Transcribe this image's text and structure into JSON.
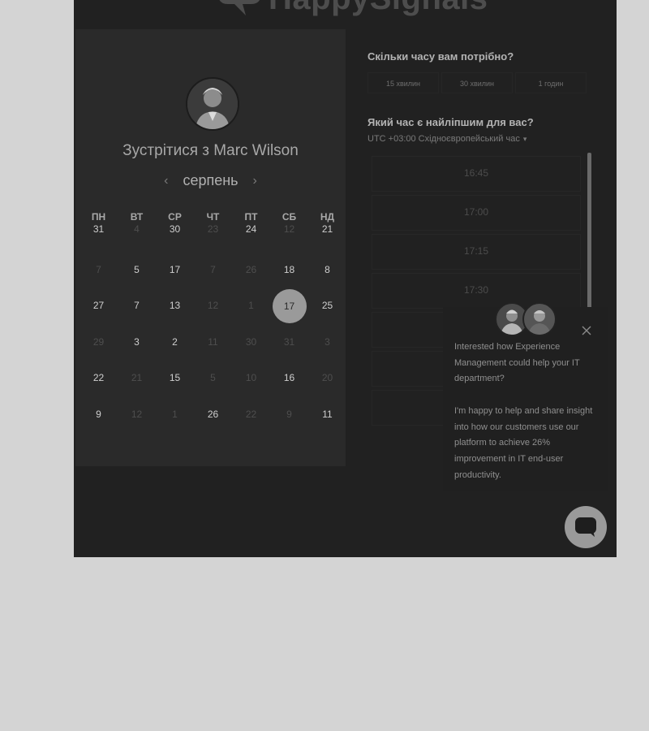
{
  "brand": {
    "name": "HappySignals"
  },
  "meeting": {
    "title": "Зустрітися з Marc Wilson",
    "month": "серпень",
    "weekdays": [
      "ПН",
      "ВТ",
      "СР",
      "ЧТ",
      "ПТ",
      "СБ",
      "НД"
    ],
    "weeks": [
      [
        {
          "d": "31",
          "dim": false
        },
        {
          "d": "4",
          "dim": true
        },
        {
          "d": "30",
          "dim": false
        },
        {
          "d": "23",
          "dim": true
        },
        {
          "d": "24",
          "dim": false
        },
        {
          "d": "12",
          "dim": true
        },
        {
          "d": "21",
          "dim": false
        }
      ],
      [
        {
          "d": "7",
          "dim": true
        },
        {
          "d": "5",
          "dim": false
        },
        {
          "d": "17",
          "dim": false
        },
        {
          "d": "7",
          "dim": true
        },
        {
          "d": "26",
          "dim": true
        },
        {
          "d": "18",
          "dim": false
        },
        {
          "d": "8",
          "dim": false
        }
      ],
      [
        {
          "d": "27",
          "dim": false
        },
        {
          "d": "7",
          "dim": false
        },
        {
          "d": "13",
          "dim": false
        },
        {
          "d": "12",
          "dim": true
        },
        {
          "d": "1",
          "dim": true
        },
        {
          "d": "17",
          "dim": false,
          "sel": true
        },
        {
          "d": "25",
          "dim": false
        }
      ],
      [
        {
          "d": "29",
          "dim": true
        },
        {
          "d": "3",
          "dim": false
        },
        {
          "d": "2",
          "dim": false
        },
        {
          "d": "11",
          "dim": true
        },
        {
          "d": "30",
          "dim": true
        },
        {
          "d": "31",
          "dim": true
        },
        {
          "d": "3",
          "dim": true
        }
      ],
      [
        {
          "d": "22",
          "dim": false
        },
        {
          "d": "21",
          "dim": true
        },
        {
          "d": "15",
          "dim": false
        },
        {
          "d": "5",
          "dim": true
        },
        {
          "d": "10",
          "dim": true
        },
        {
          "d": "16",
          "dim": false
        },
        {
          "d": "20",
          "dim": true
        }
      ],
      [
        {
          "d": "9",
          "dim": false
        },
        {
          "d": "12",
          "dim": true
        },
        {
          "d": "1",
          "dim": true
        },
        {
          "d": "26",
          "dim": false
        },
        {
          "d": "22",
          "dim": true
        },
        {
          "d": "9",
          "dim": true
        },
        {
          "d": "11",
          "dim": false
        }
      ]
    ]
  },
  "duration": {
    "question": "Скільки часу вам потрібно?",
    "options": [
      "15 хвилин",
      "30 хвилин",
      "1 годин"
    ]
  },
  "time": {
    "question": "Який час є найліпшим для вас?",
    "timezone": "UTC +03:00 Східноєвропейський час",
    "slots": [
      "16:45",
      "17:00",
      "17:15",
      "17:30",
      "",
      "",
      ""
    ]
  },
  "popup": {
    "paragraph1": "Interested how Experience Management could help your IT department?",
    "paragraph2": "I'm happy to help and share insight into how our customers use our platform to achieve 26% improvement in IT end-user productivity."
  },
  "colors": {
    "accent": "#9a9a9a",
    "background": "#212121",
    "panel": "#2a2a2a"
  }
}
